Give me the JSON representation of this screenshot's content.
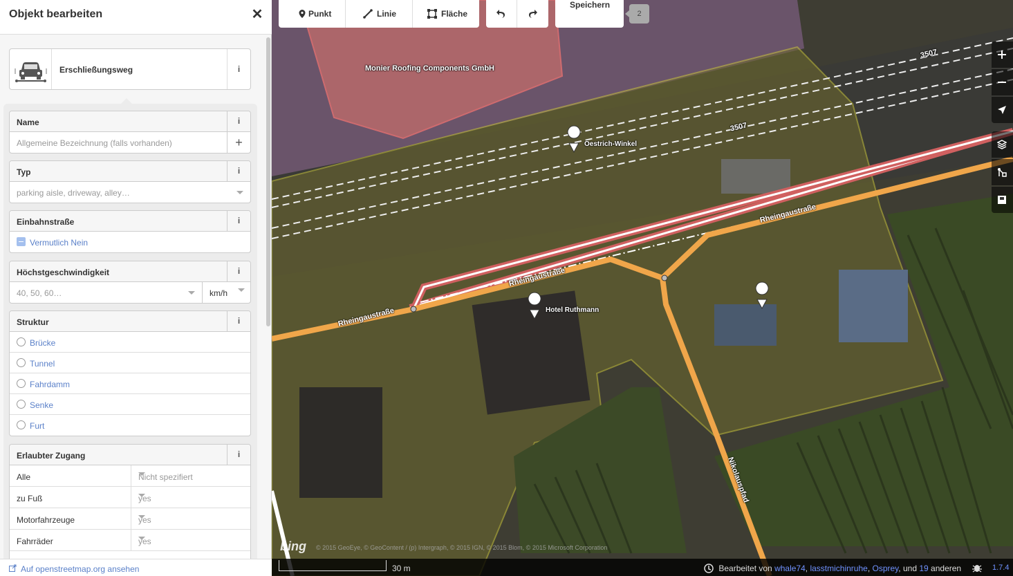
{
  "sidebar": {
    "title": "Objekt bearbeiten",
    "close_icon": "close-icon",
    "preset": {
      "name": "Erschließungsweg",
      "icon": "car-icon",
      "info": "i"
    },
    "fields": {
      "name": {
        "label": "Name",
        "placeholder": "Allgemeine Bezeichnung (falls vorhanden)",
        "info": "i",
        "add": "+"
      },
      "typ": {
        "label": "Typ",
        "placeholder": "parking aisle, driveway, alley…",
        "info": "i"
      },
      "oneway": {
        "label": "Einbahnstraße",
        "value": "Vermutlich Nein",
        "info": "i"
      },
      "maxspeed": {
        "label": "Höchstgeschwindigkeit",
        "placeholder": "40, 50, 60…",
        "unit": "km/h",
        "info": "i"
      },
      "structure": {
        "label": "Struktur",
        "info": "i",
        "options": [
          "Brücke",
          "Tunnel",
          "Fahrdamm",
          "Senke",
          "Furt"
        ]
      },
      "access": {
        "label": "Erlaubter Zugang",
        "info": "i",
        "rows": [
          {
            "key": "Alle",
            "value": "Nicht spezifiert"
          },
          {
            "key": "zu Fuß",
            "value": "yes"
          },
          {
            "key": "Motorfahrzeuge",
            "value": "yes"
          },
          {
            "key": "Fahrräder",
            "value": "yes"
          }
        ]
      }
    },
    "footer_link": "Auf openstreetmap.org ansehen"
  },
  "toolbar": {
    "point": "Punkt",
    "line": "Linie",
    "area": "Fläche",
    "save": "Speichern",
    "save_count": "2"
  },
  "map": {
    "labels": {
      "company": "Monier Roofing Components GmbH",
      "station": "Oestrich-Winkel",
      "hotel": "Hotel Ruthmann",
      "road1": "Rheingaustraße",
      "road2": "Rheingaustraße",
      "road3": "Rheingaustraße",
      "road4": "Nikolauspfad",
      "rail1": "3507",
      "rail2": "3507"
    },
    "scale": "30 m",
    "attribution": "© 2015 GeoEye, © GeoContent / (p) Intergraph, © 2015 IGN, © 2015 Blom, © 2015 Microsoft Corporation",
    "bing": "bing",
    "contributors_prefix": "Bearbeitet von",
    "contributors": [
      "whale74",
      "lasstmichinruhe",
      "Osprey"
    ],
    "contributors_and": "und",
    "others_count": "19",
    "others_suffix": "anderen",
    "version": "1.7.4"
  }
}
